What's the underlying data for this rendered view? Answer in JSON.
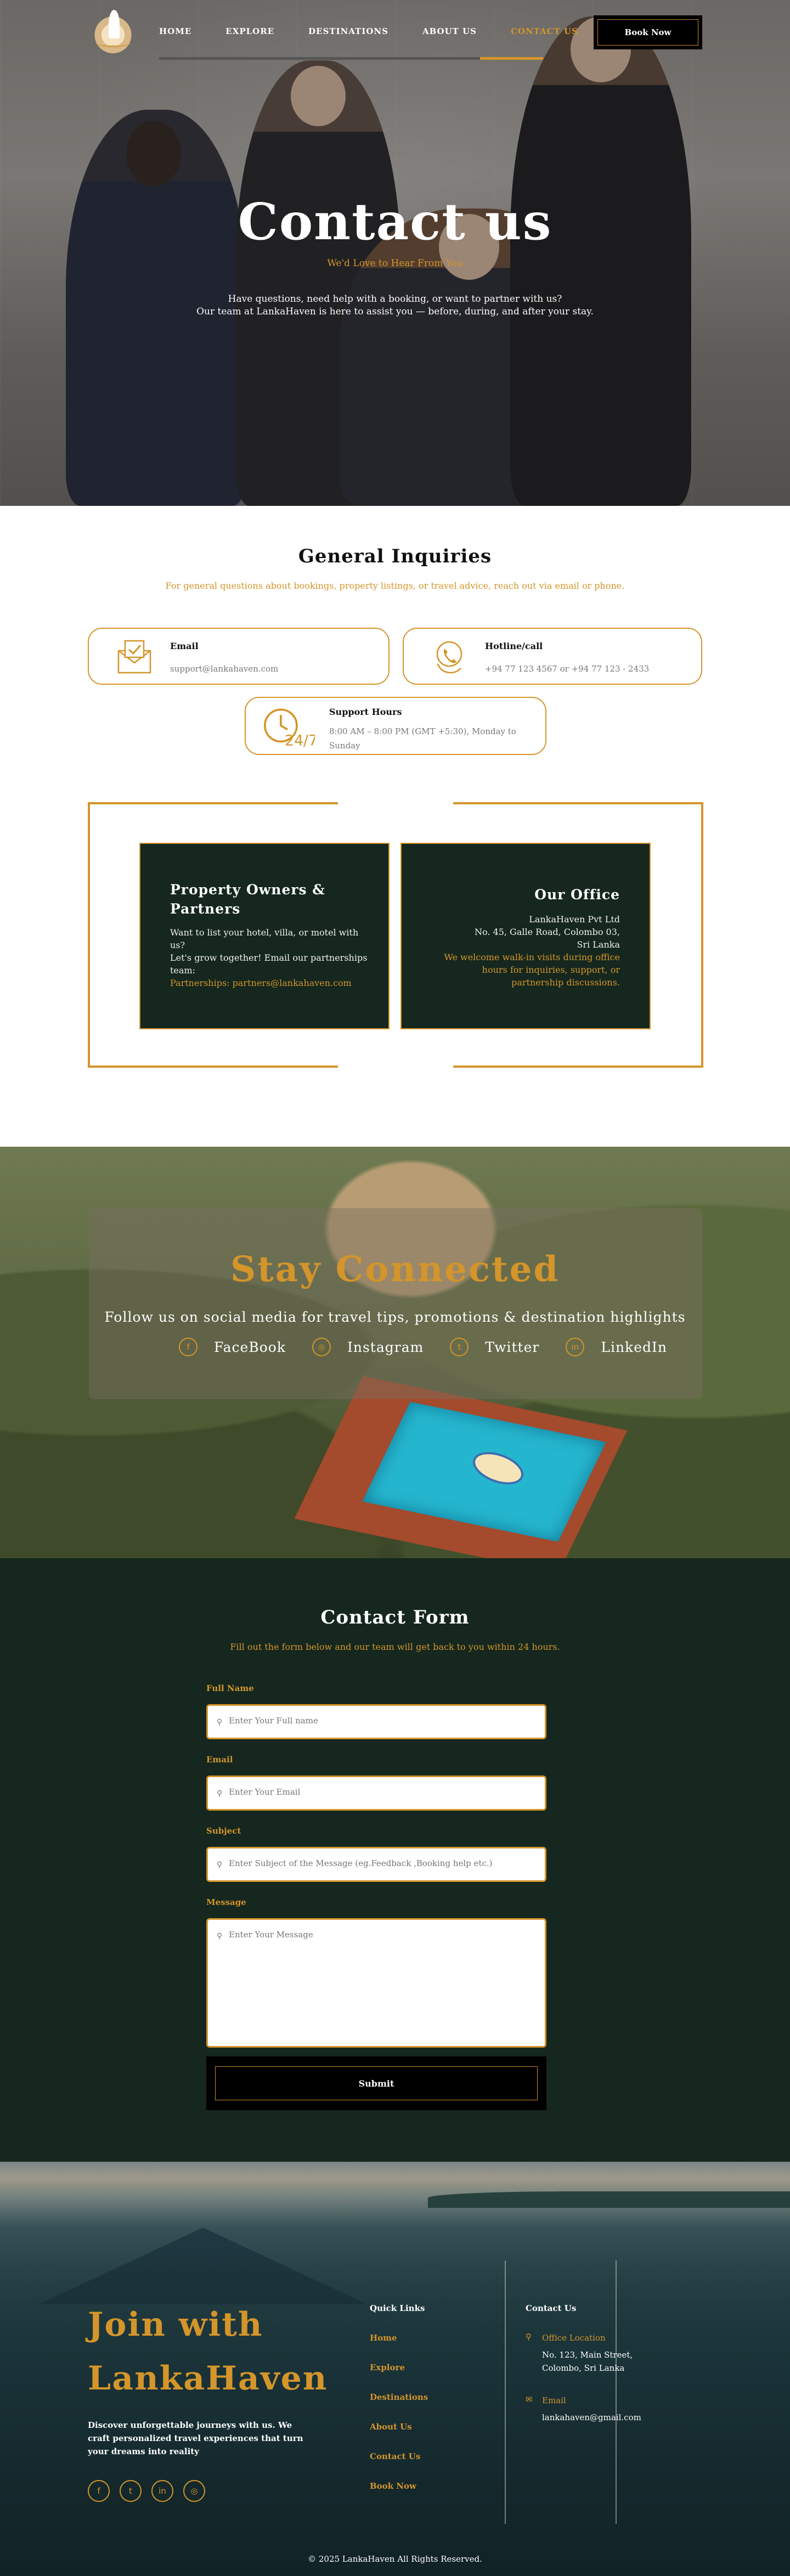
{
  "nav": {
    "links": [
      "HOME",
      "EXPLORE",
      "DESTINATIONS",
      "ABOUT US",
      "CONTACT US"
    ],
    "book_label": "Book Now"
  },
  "hero": {
    "title": "Contact us",
    "subtitle": "We'd Love to Hear From You",
    "desc_line1": "Have questions, need help with a booking, or want to partner with us?",
    "desc_line2": "Our team at LankaHaven is here to assist you — before, during, and after your stay."
  },
  "inquiries": {
    "title": "General Inquiries",
    "lead": "For general questions about bookings, property listings, or travel advice, reach out via email or phone.",
    "cards": [
      {
        "title": "Email",
        "value": "support@lankahaven.com",
        "icon": "envelope-icon"
      },
      {
        "title": "Hotline/call",
        "value": "+94 77 123 4567 or +94 77 123 - 2433",
        "icon": "phone-hand-icon"
      },
      {
        "title": "Support Hours",
        "value": "8:00 AM – 8:00 PM (GMT +5:30), Monday to Sunday",
        "icon": "clock-24-7-icon"
      }
    ],
    "owners": {
      "title": "Property Owners & Partners",
      "line1": "Want to list your hotel, villa, or motel with us?",
      "line2": "Let's grow together! Email our partnerships team:",
      "line3": "Partnerships: partners@lankahaven.com"
    },
    "office": {
      "title": "Our Office",
      "line1": "LankaHaven Pvt Ltd",
      "line2": "No. 45, Galle Road, Colombo 03,",
      "line3": "Sri Lanka",
      "line4": "We welcome walk-in visits during office hours for inquiries, support, or partnership discussions."
    }
  },
  "social": {
    "title": "Stay Connected",
    "tagline": "Follow us on social media for travel tips, promotions & destination highlights",
    "links": [
      {
        "label": "FaceBook",
        "icon": "facebook-icon",
        "glyph": "f"
      },
      {
        "label": "Instagram",
        "icon": "instagram-icon",
        "glyph": "◎"
      },
      {
        "label": "Twitter",
        "icon": "twitter-icon",
        "glyph": "t"
      },
      {
        "label": "LinkedIn",
        "icon": "linkedin-icon",
        "glyph": "in"
      }
    ]
  },
  "form": {
    "title": "Contact Form",
    "lead": "Fill out the form below and our team will get back to you within 24 hours.",
    "fields": [
      {
        "label": "Full Name",
        "placeholder": "Enter Your Full name"
      },
      {
        "label": "Email",
        "placeholder": "Enter Your Email"
      },
      {
        "label": "Subject",
        "placeholder": "Enter Subject of the Message (eg.Feedback ,Booking help etc.)"
      },
      {
        "label": "Message",
        "placeholder": "Enter Your Message"
      }
    ],
    "submit_label": "Submit"
  },
  "footer": {
    "join_line1": "Join with",
    "join_line2": "LankaHaven",
    "desc": "Discover unforgettable journeys with us. We craft personalized travel experiences that turn your dreams into reality",
    "quick_title": "Quick Links",
    "quick_links": [
      "Home",
      "Explore",
      "Destinations",
      "About Us",
      "Contact Us",
      "Book Now"
    ],
    "contact_title": "Contact Us",
    "office_label": "Office Location",
    "office_line1": "No. 123, Main Street,",
    "office_line2": "Colombo, Sri Lanka",
    "email_label": "Email",
    "email_value": "lankahaven@gmail.com",
    "copyright": "© 2025 LankaHaven All Rights Reserved."
  },
  "colors": {
    "accent": "#d4952a",
    "dark_green": "#15271e"
  }
}
